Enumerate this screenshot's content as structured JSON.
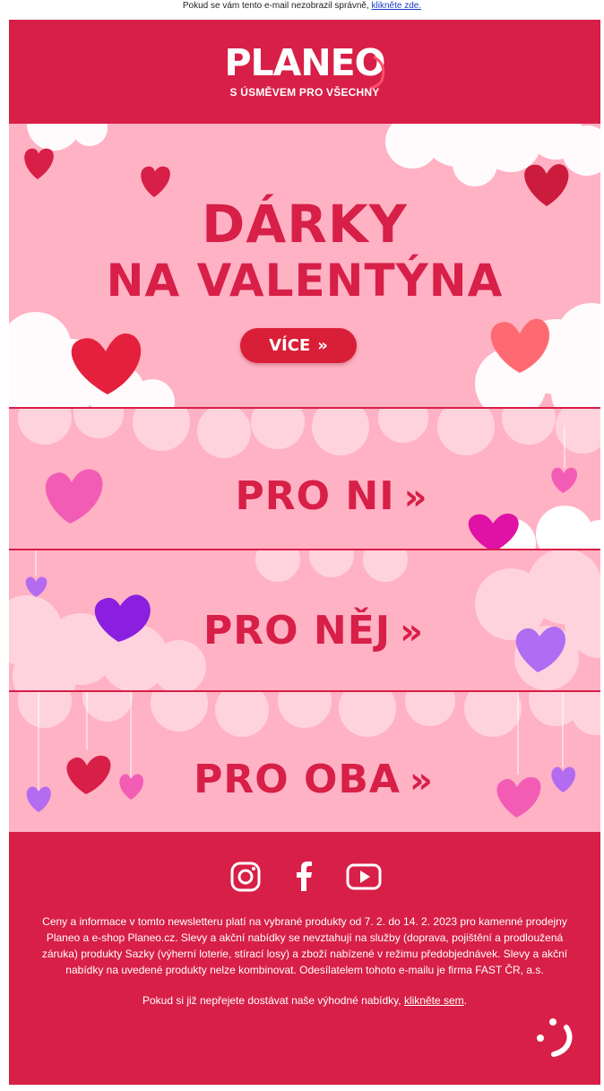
{
  "preheader": {
    "text": "Pokud se vám tento e-mail nezobrazil správně,",
    "link": "klikněte zde."
  },
  "header": {
    "logo": "PLANEO",
    "tagline": "S ÚSMĚVEM PRO VŠECHNY"
  },
  "hero": {
    "title_line1": "DÁRKY",
    "title_line2": "NA VALENTÝNA",
    "cta_label": "VÍCE"
  },
  "banners": [
    {
      "label": "PRO NI"
    },
    {
      "label": "PRO NĚJ"
    },
    {
      "label": "PRO OBA"
    }
  ],
  "arrow_glyph": "»",
  "footer": {
    "social": [
      "instagram-icon",
      "facebook-icon",
      "youtube-icon"
    ],
    "legal": "Ceny a informace v tomto newsletteru platí na vybrané produkty od 7. 2. do 14. 2. 2023 pro kamenné prodejny Planeo a e-shop Planeo.cz. Slevy a akční nabídky se nevztahují na služby (doprava, pojištění a prodloužená záruka) produkty Sazky (výherní loterie, stírací losy) a zboží nabízené v režimu předobjednávek. Slevy a akční nabídky na uvedené produkty nelze kombinovat. Odesílatelem tohoto e-mailu je firma FAST ČR, a.s.",
    "unsub_text": "Pokud si již nepřejete dostávat naše výhodné nabídky,",
    "unsub_link": "klikněte sem"
  },
  "colors": {
    "brand_red": "#d81f47",
    "pink_bg": "#ffb2c4",
    "heart_red": "#e0283f",
    "heart_purple": "#9a3cf0",
    "heart_pink": "#f35cb5"
  }
}
